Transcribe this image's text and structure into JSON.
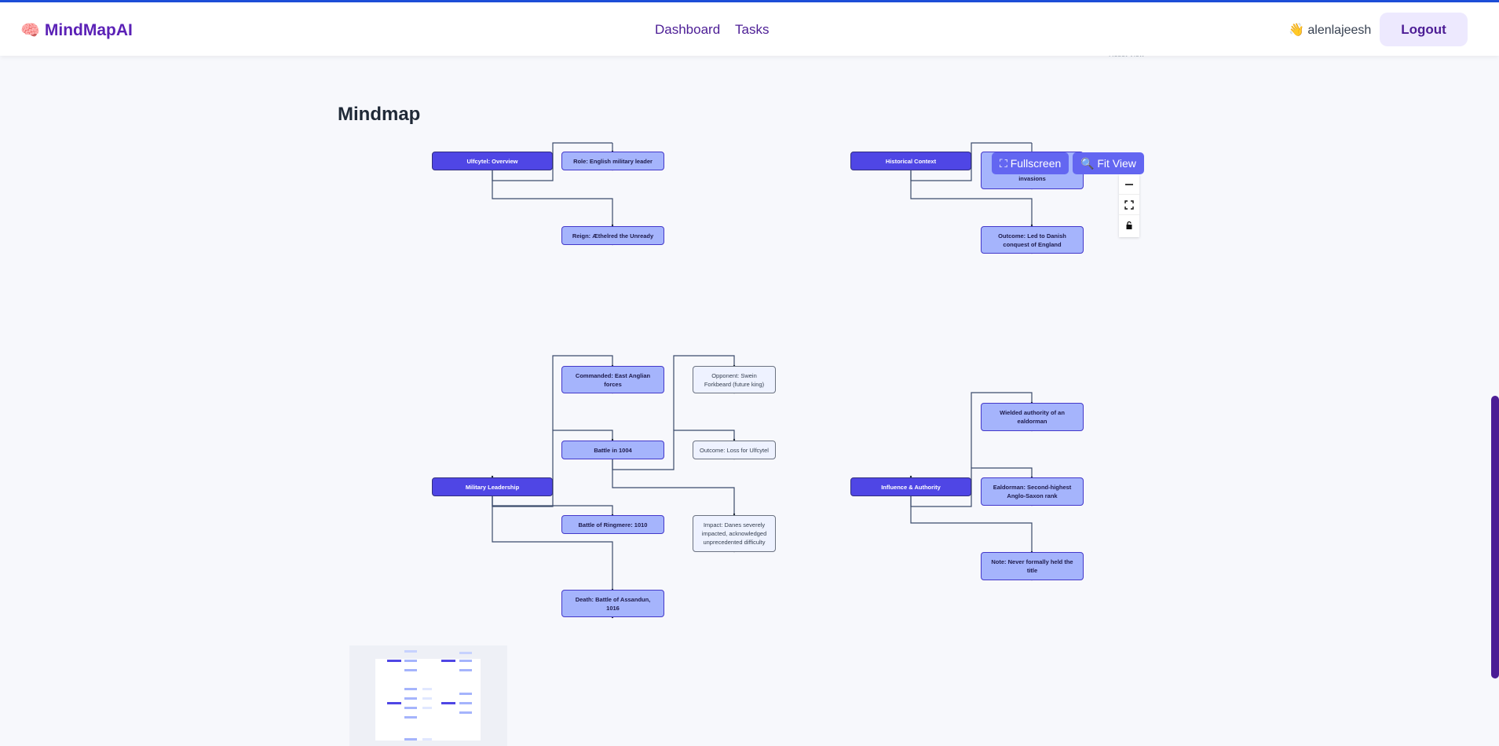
{
  "app": {
    "brand": "MindMapAI",
    "brand_icon": "🧠",
    "nav": [
      "Dashboard",
      "Tasks"
    ],
    "user": "👋 alenlajeesh",
    "logout": "Logout"
  },
  "page": {
    "title": "Mindmap"
  },
  "toolbar": {
    "fullscreen": "⛶ Fullscreen",
    "fit_view": "🔍 Fit View"
  },
  "controls": [
    "zoom-out-icon",
    "fit-view-icon",
    "lock-icon"
  ],
  "mindmap": {
    "nodes": [
      {
        "id": "overview",
        "label": "Ulfcytel: Overview",
        "level": "root"
      },
      {
        "id": "role",
        "label": "Role: English military leader",
        "level": "mid"
      },
      {
        "id": "reign",
        "label": "Reign: Æthelred the Unready",
        "level": "mid"
      },
      {
        "id": "context",
        "label": "Historical Context",
        "level": "root"
      },
      {
        "id": "invasions",
        "label": "invasions",
        "level": "mid"
      },
      {
        "id": "outcome_ctx",
        "label": "Outcome: Led to Danish conquest of England",
        "level": "mid"
      },
      {
        "id": "military",
        "label": "Military Leadership",
        "level": "root"
      },
      {
        "id": "east_anglian",
        "label": "Commanded: East Anglian forces",
        "level": "mid"
      },
      {
        "id": "battle1004",
        "label": "Battle in 1004",
        "level": "mid"
      },
      {
        "id": "opponent",
        "label": "Opponent: Swein Forkbeard (future king)",
        "level": "leaf"
      },
      {
        "id": "loss",
        "label": "Outcome: Loss for Ulfcytel",
        "level": "leaf"
      },
      {
        "id": "impact",
        "label": "Impact: Danes severely impacted, acknowledged unprecedented difficulty",
        "level": "leaf"
      },
      {
        "id": "ringmere",
        "label": "Battle of Ringmere: 1010",
        "level": "mid"
      },
      {
        "id": "death",
        "label": "Death: Battle of Assandun, 1016",
        "level": "mid"
      },
      {
        "id": "influence",
        "label": "Influence & Authority",
        "level": "root"
      },
      {
        "id": "ealdorman_auth",
        "label": "Wielded authority of an ealdorman",
        "level": "mid"
      },
      {
        "id": "ealdorman_rank",
        "label": "Ealdorman: Second-highest Anglo-Saxon rank",
        "level": "mid"
      },
      {
        "id": "note",
        "label": "Note: Never formally held the title",
        "level": "mid"
      }
    ]
  },
  "colors": {
    "root": "#4f46e5",
    "mid": "#a5b4fc",
    "leaf": "#eef2ff",
    "edge": "#3b4b6b",
    "accent": "#5b21b6"
  }
}
